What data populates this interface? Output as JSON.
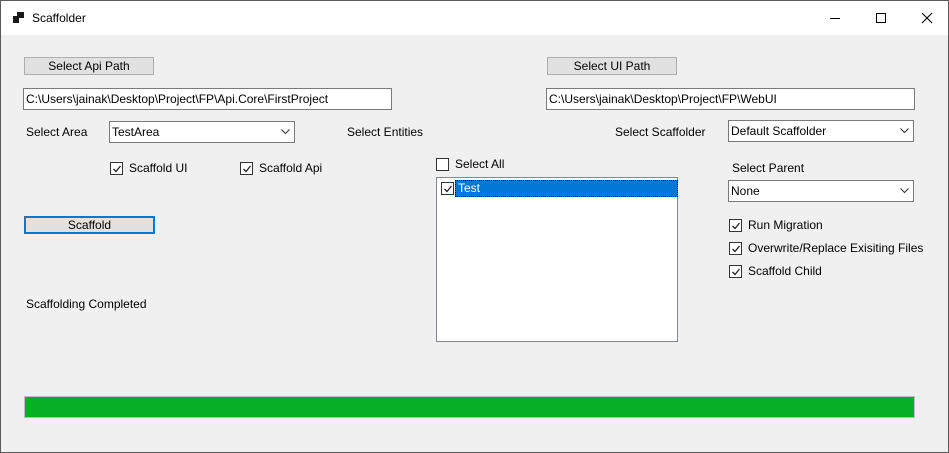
{
  "window": {
    "title": "Scaffolder"
  },
  "icons": {
    "app": "app-icon",
    "minimize": "minimize-icon",
    "maximize": "maximize-icon",
    "close": "close-icon",
    "dropdown": "chevron-down-icon",
    "check": "checkmark-icon"
  },
  "api": {
    "button_label": "Select Api Path",
    "path": "C:\\Users\\jainak\\Desktop\\Project\\FP\\Api.Core\\FirstProject"
  },
  "ui": {
    "button_label": "Select UI Path",
    "path": "C:\\Users\\jainak\\Desktop\\Project\\FP\\WebUI"
  },
  "area": {
    "label": "Select Area",
    "value": "TestArea"
  },
  "scaffold_ui": {
    "label": "Scaffold UI",
    "checked": true
  },
  "scaffold_api": {
    "label": "Scaffold Api",
    "checked": true
  },
  "scaffold_button": {
    "label": "Scaffold"
  },
  "status": {
    "text": "Scaffolding Completed"
  },
  "entities": {
    "label": "Select Entities",
    "select_all": {
      "label": "Select All",
      "checked": false
    },
    "items": [
      {
        "label": "Test",
        "checked": true,
        "selected": true
      }
    ]
  },
  "scaffolder": {
    "label": "Select Scaffolder",
    "value": "Default Scaffolder"
  },
  "parent": {
    "label": "Select Parent",
    "value": "None"
  },
  "options": {
    "run_migration": {
      "label": "Run Migration",
      "checked": true
    },
    "overwrite": {
      "label": "Overwrite/Replace Exisiting Files",
      "checked": true
    },
    "scaffold_child": {
      "label": "Scaffold Child",
      "checked": true
    }
  },
  "progress": {
    "value": 1.0
  },
  "colors": {
    "progress_fill": "#06b025",
    "selection": "#0078d7",
    "accent_border": "#0078d7"
  }
}
